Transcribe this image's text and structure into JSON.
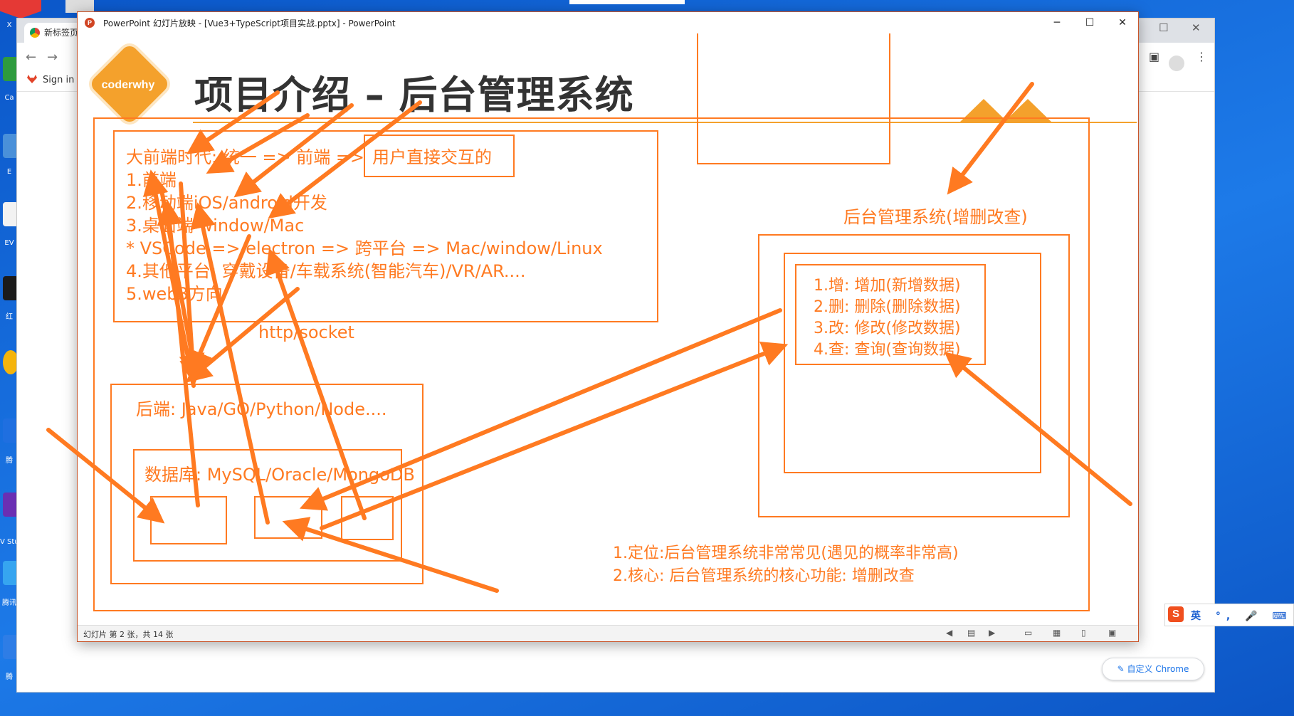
{
  "desktop": {
    "icons": [
      {
        "label": "X",
        "color": "#e53935"
      },
      {
        "label": "Ca",
        "color": "#2e9b3e"
      },
      {
        "label": "E",
        "color": "#4a90d9"
      },
      {
        "label": "EV",
        "color": "#f2f2f2"
      },
      {
        "label": "红",
        "color": "#1b1b1b"
      },
      {
        "label": "",
        "color": "#f5b40b"
      },
      {
        "label": "腾",
        "color": "#1f6fe0"
      },
      {
        "label": "V Stud",
        "color": "#6a2fb3"
      },
      {
        "label": "腾讯",
        "color": "#36a5f0"
      },
      {
        "label": "腾",
        "color": "#2e7de6"
      }
    ]
  },
  "chrome": {
    "tab_label": "新标签页",
    "bookmark_sign_in": "Sign in · GitLab",
    "customize_button": "自定义 Chrome"
  },
  "ppt": {
    "window_title": "PowerPoint 幻灯片放映 - [Vue3+TypeScript项目实战.pptx] - PowerPoint",
    "logo_letter": "P",
    "min_label": "─",
    "max_label": "☐",
    "close_label": "✕",
    "status": "幻灯片 第 2 张，共 14 张",
    "accent_color": "#ff7a21",
    "slide": {
      "logo_text": "coderwhy",
      "title": "项目介绍 – 后台管理系统",
      "frontend_lines": [
        "大前端时代: 统一 => 前端 =>",
        "1.前端",
        "2.移动端iOS/android开发",
        "3.桌面端 window/Mac",
        "* VSCode => electron => 跨平台 => Mac/window/Linux",
        "4.其他平台: 穿戴设备/车载系统(智能汽车)/VR/AR....",
        "5.web3方向"
      ],
      "user_interaction": "用户直接交互的",
      "http_socket": "http/socket",
      "backend": "后端: Java/GO/Python/Node....",
      "database": "数据库: MySQL/Oracle/MongoDB",
      "admin_title": "后台管理系统(增删改查)",
      "crud_lines": [
        "1.增: 增加(新增数据)",
        "2.删: 删除(删除数据)",
        "3.改: 修改(修改数据)",
        "4.查: 查询(查询数据)"
      ],
      "notes": [
        "1.定位:后台管理系统非常常见(遇见的概率非常高)",
        "2.核心: 后台管理系统的核心功能: 增删改查"
      ]
    }
  },
  "ime": {
    "logo": "S",
    "items": "英 °, 🎤 ⌨ 👕 ▦"
  }
}
